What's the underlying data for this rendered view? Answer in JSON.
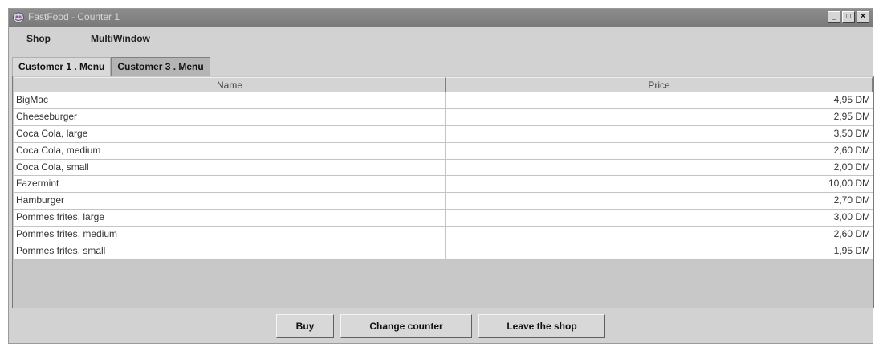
{
  "window": {
    "title": "FastFood - Counter 1",
    "controls": [
      "_",
      "□",
      "×"
    ]
  },
  "menubar": {
    "items": [
      {
        "label": "Shop"
      },
      {
        "label": "MultiWindow"
      }
    ]
  },
  "tabs": [
    {
      "label": "Customer 1 . Menu",
      "active": true
    },
    {
      "label": "Customer 3 . Menu",
      "active": false
    }
  ],
  "table": {
    "columns": [
      "Name",
      "Price"
    ],
    "rows": [
      {
        "name": "BigMac",
        "price": "4,95 DM"
      },
      {
        "name": "Cheeseburger",
        "price": "2,95 DM"
      },
      {
        "name": "Coca Cola, large",
        "price": "3,50 DM"
      },
      {
        "name": "Coca Cola, medium",
        "price": "2,60 DM"
      },
      {
        "name": "Coca Cola, small",
        "price": "2,00 DM"
      },
      {
        "name": "Fazermint",
        "price": "10,00 DM"
      },
      {
        "name": "Hamburger",
        "price": "2,70 DM"
      },
      {
        "name": "Pommes frites, large",
        "price": "3,00 DM"
      },
      {
        "name": "Pommes frites, medium",
        "price": "2,60 DM"
      },
      {
        "name": "Pommes frites, small",
        "price": "1,95 DM"
      }
    ]
  },
  "buttons": {
    "buy": "Buy",
    "change_counter": "Change counter",
    "leave": "Leave the shop"
  },
  "icons": {
    "app": "app-cup-icon"
  }
}
